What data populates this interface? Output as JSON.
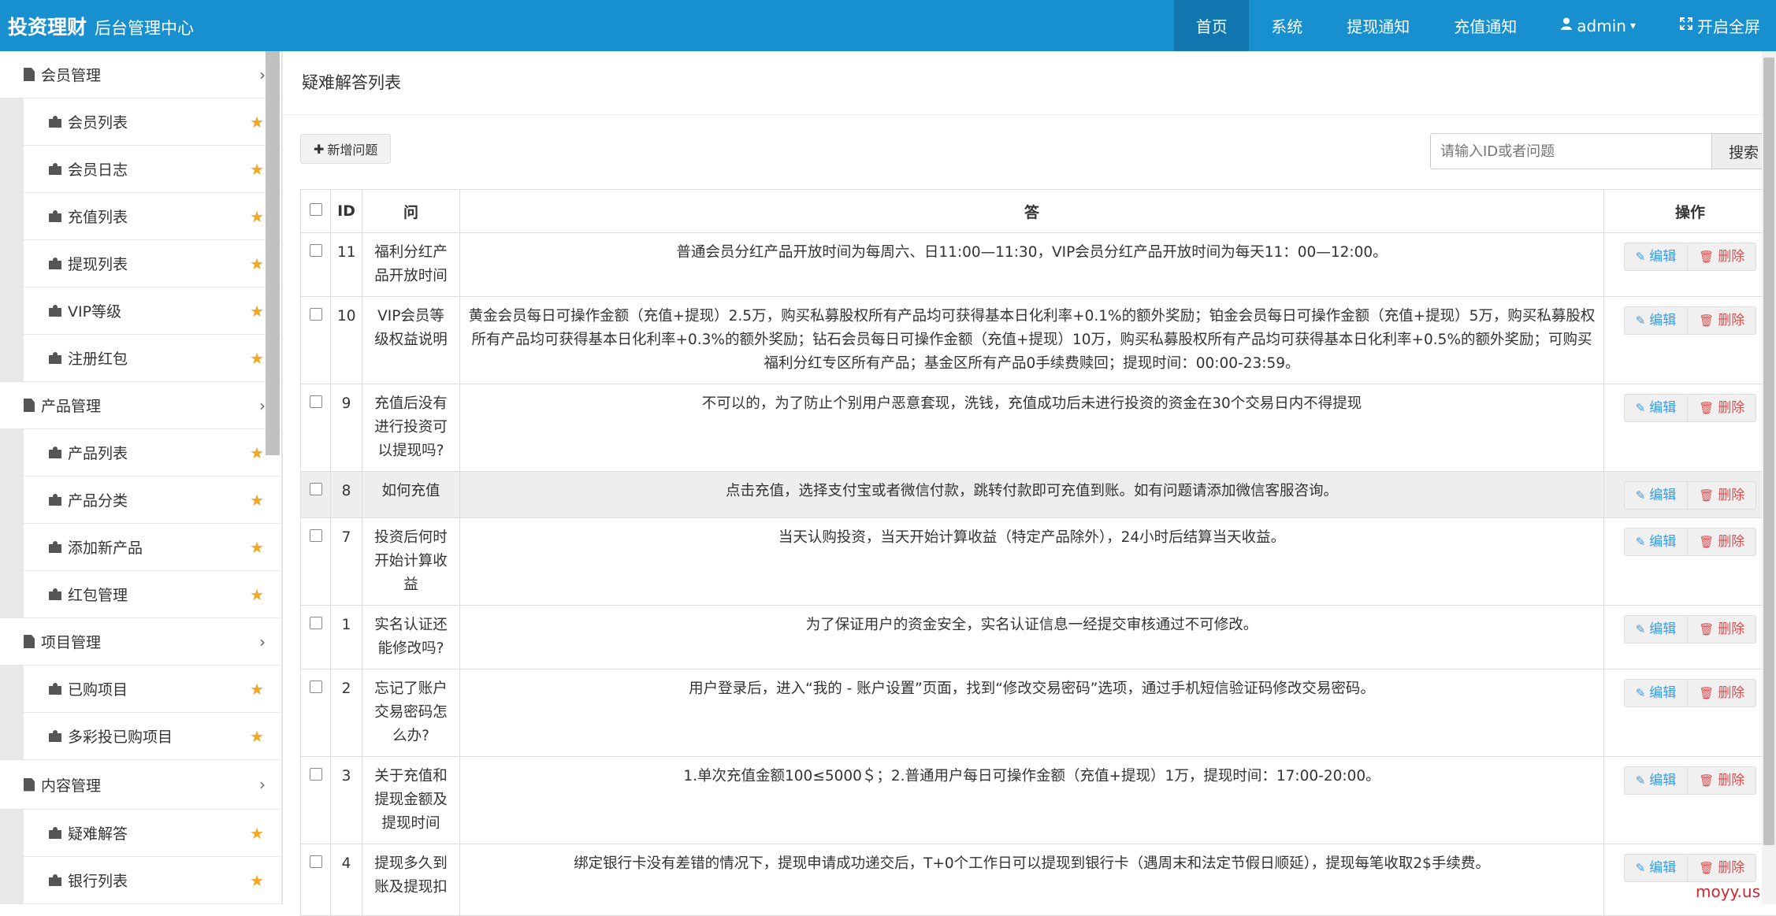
{
  "header": {
    "brand": "投资理财",
    "subtitle": "后台管理中心",
    "nav": [
      {
        "label": "首页",
        "active": true
      },
      {
        "label": "系统"
      },
      {
        "label": "提现通知"
      },
      {
        "label": "充值通知"
      },
      {
        "label": "admin",
        "icon": "user-icon",
        "dropdown": "▾"
      },
      {
        "label": "开启全屏",
        "icon": "fullscreen-icon"
      }
    ]
  },
  "sidebar": {
    "groups": [
      {
        "label": "会员管理",
        "items": [
          "会员列表",
          "会员日志",
          "充值列表",
          "提现列表",
          "VIP等级",
          "注册红包"
        ]
      },
      {
        "label": "产品管理",
        "items": [
          "产品列表",
          "产品分类",
          "添加新产品",
          "红包管理"
        ]
      },
      {
        "label": "项目管理",
        "items": [
          "已购项目",
          "多彩投已购项目"
        ]
      },
      {
        "label": "内容管理",
        "items": [
          "疑难解答",
          "银行列表"
        ]
      }
    ],
    "chevron": "›",
    "star": "★"
  },
  "main": {
    "title": "疑难解答列表",
    "add_button": "新增问题",
    "search_placeholder": "请输入ID或者问题",
    "search_button": "搜索",
    "columns": {
      "id": "ID",
      "question": "问",
      "answer": "答",
      "ops": "操作"
    },
    "edit_label": "编辑",
    "delete_label": "删除",
    "rows": [
      {
        "id": "11",
        "question": "福利分红产品开放时间",
        "answer": "普通会员分红产品开放时间为每周六、日11:00—11:30，VIP会员分红产品开放时间为每天11：00—12:00。"
      },
      {
        "id": "10",
        "question": "VIP会员等级权益说明",
        "answer": "黄金会员每日可操作金额（充值+提现）2.5万，购买私募股权所有产品均可获得基本日化利率+0.1%的额外奖励；铂金会员每日可操作金额（充值+提现）5万，购买私募股权所有产品均可获得基本日化利率+0.3%的额外奖励；钻石会员每日可操作金额（充值+提现）10万，购买私募股权所有产品均可获得基本日化利率+0.5%的额外奖励；可购买福利分红专区所有产品；基金区所有产品0手续费赎回；提现时间：00:00-23:59。"
      },
      {
        "id": "9",
        "question": "充值后没有进行投资可以提现吗?",
        "answer": "不可以的，为了防止个别用户恶意套现，洗钱，充值成功后未进行投资的资金在30个交易日内不得提现"
      },
      {
        "id": "8",
        "question": "如何充值",
        "answer": "点击充值，选择支付宝或者微信付款，跳转付款即可充值到账。如有问题请添加微信客服咨询。",
        "highlight": true
      },
      {
        "id": "7",
        "question": "投资后何时开始计算收益",
        "answer": "当天认购投资，当天开始计算收益（特定产品除外），24小时后结算当天收益。"
      },
      {
        "id": "1",
        "question": "实名认证还能修改吗?",
        "answer": "为了保证用户的资金安全，实名认证信息一经提交审核通过不可修改。"
      },
      {
        "id": "2",
        "question": "忘记了账户交易密码怎么办?",
        "answer": "用户登录后，进入“我的 - 账户设置”页面，找到“修改交易密码”选项，通过手机短信验证码修改交易密码。"
      },
      {
        "id": "3",
        "question": "关于充值和提现金额及提现时间",
        "answer": "1.单次充值金额100≤5000＄；2.普通用户每日可操作金额（充值+提现）1万，提现时间：17:00-20:00。"
      },
      {
        "id": "4",
        "question": "提现多久到账及提现扣",
        "answer": "绑定银行卡没有差错的情况下，提现申请成功递交后，T+0个工作日可以提现到银行卡（遇周末和法定节假日顺延），提现每笔收取2$手续费。"
      }
    ]
  },
  "watermark": "moyy.us",
  "colors": {
    "topbar": "#1890d0",
    "topbar_active": "#1176b0",
    "star": "#f5a623",
    "edit": "#3a9be0",
    "delete": "#e04b4b",
    "highlight_row": "#eeeeee"
  }
}
